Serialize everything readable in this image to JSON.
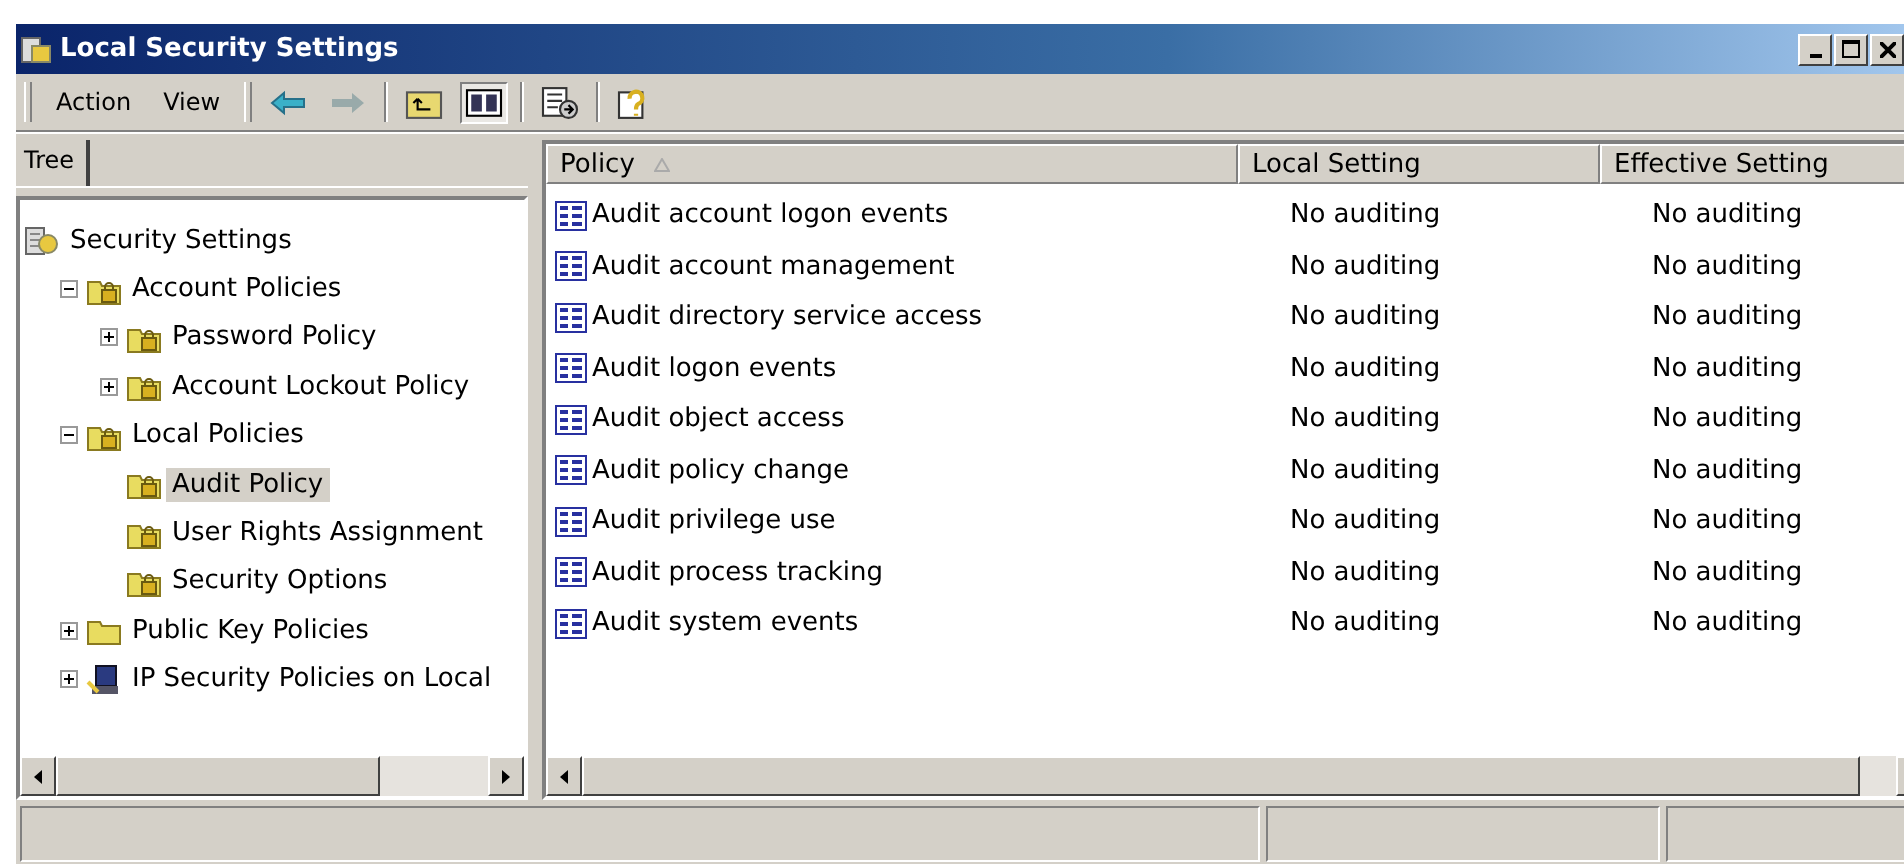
{
  "window": {
    "title": "Local Security Settings"
  },
  "menu": [
    {
      "label": "Action"
    },
    {
      "label": "View"
    }
  ],
  "tree_tab": {
    "label": "Tree"
  },
  "tree": [
    {
      "label": "Security Settings",
      "kind": "root",
      "selected": false,
      "children": [
        {
          "label": "Account Policies",
          "kind": "locked-folder",
          "selected": false,
          "expanded": true,
          "children": [
            {
              "label": "Password Policy",
              "kind": "locked-folder",
              "selected": false,
              "expanded": false
            },
            {
              "label": "Account Lockout Policy",
              "kind": "locked-folder",
              "selected": false,
              "expanded": false
            }
          ]
        },
        {
          "label": "Local Policies",
          "kind": "locked-folder",
          "selected": false,
          "expanded": true,
          "children": [
            {
              "label": "Audit Policy",
              "kind": "locked-folder",
              "selected": true
            },
            {
              "label": "User Rights Assignment",
              "kind": "locked-folder",
              "selected": false
            },
            {
              "label": "Security Options",
              "kind": "locked-folder",
              "selected": false
            }
          ]
        },
        {
          "label": "Public Key Policies",
          "kind": "folder",
          "selected": false,
          "expanded": false
        },
        {
          "label": "IP Security Policies on Local",
          "kind": "computer",
          "selected": false,
          "expanded": false
        }
      ]
    }
  ],
  "table": {
    "columns": [
      "Policy",
      "Local Setting",
      "Effective Setting"
    ],
    "rows": [
      {
        "policy": "Audit account logon events",
        "local": "No auditing",
        "effective": "No auditing"
      },
      {
        "policy": "Audit account management",
        "local": "No auditing",
        "effective": "No auditing"
      },
      {
        "policy": "Audit directory service access",
        "local": "No auditing",
        "effective": "No auditing"
      },
      {
        "policy": "Audit logon events",
        "local": "No auditing",
        "effective": "No auditing"
      },
      {
        "policy": "Audit object access",
        "local": "No auditing",
        "effective": "No auditing"
      },
      {
        "policy": "Audit policy change",
        "local": "No auditing",
        "effective": "No auditing"
      },
      {
        "policy": "Audit privilege use",
        "local": "No auditing",
        "effective": "No auditing"
      },
      {
        "policy": "Audit process tracking",
        "local": "No auditing",
        "effective": "No auditing"
      },
      {
        "policy": "Audit system events",
        "local": "No auditing",
        "effective": "No auditing"
      }
    ]
  }
}
